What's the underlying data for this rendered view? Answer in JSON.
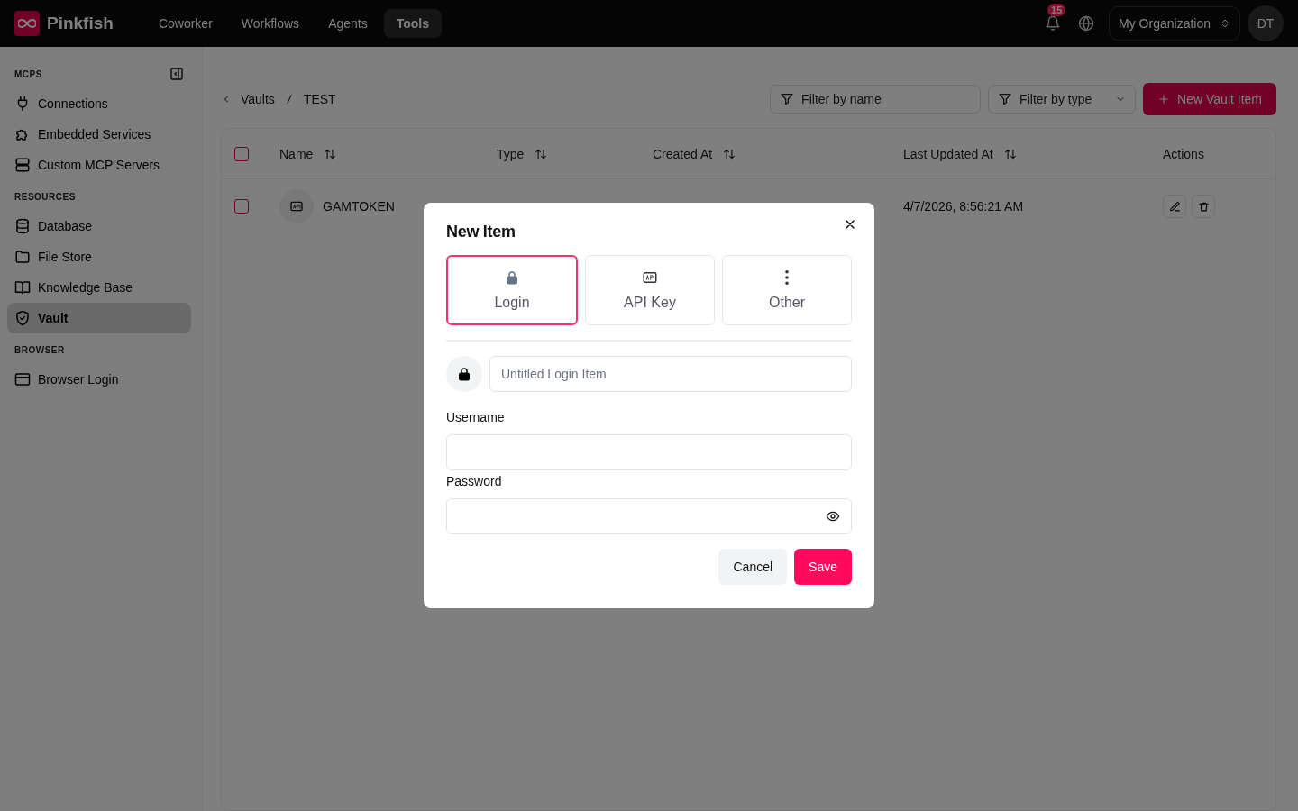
{
  "top_nav": {
    "brand": "Pinkfish",
    "items": [
      {
        "label": "Coworker",
        "selected": false
      },
      {
        "label": "Workflows",
        "selected": false
      },
      {
        "label": "Agents",
        "selected": false
      },
      {
        "label": "Tools",
        "selected": true
      }
    ],
    "notification_count": "15",
    "organization": "My Organization",
    "avatar": "DT"
  },
  "sidebar": {
    "sections": [
      {
        "title": "MCPS",
        "items": [
          {
            "label": "Connections",
            "kind": "plug",
            "selected": false
          },
          {
            "label": "Embedded Services",
            "kind": "puzzle",
            "selected": false
          },
          {
            "label": "Custom MCP Servers",
            "kind": "server",
            "selected": false
          }
        ]
      },
      {
        "title": "RESOURCES",
        "items": [
          {
            "label": "Database",
            "kind": "database",
            "selected": false
          },
          {
            "label": "File Store",
            "kind": "folder",
            "selected": false
          },
          {
            "label": "Knowledge Base",
            "kind": "book",
            "selected": false
          },
          {
            "label": "Vault",
            "kind": "shield",
            "selected": true
          }
        ]
      },
      {
        "title": "BROWSER",
        "items": [
          {
            "label": "Browser Login",
            "kind": "browser",
            "selected": false
          }
        ]
      }
    ]
  },
  "breadcrumb": [
    "Vaults",
    "TEST"
  ],
  "filters": {
    "name_placeholder": "Filter by name",
    "type_placeholder": "Filter by type"
  },
  "new_button": "New Vault Item",
  "table": {
    "all_selected": false,
    "columns": [
      {
        "label": "Name",
        "sortable": true
      },
      {
        "label": "Type",
        "sortable": true
      },
      {
        "label": "Created At",
        "sortable": true
      },
      {
        "label": "Last Updated At",
        "sortable": true
      },
      {
        "label": "Actions",
        "sortable": false
      }
    ],
    "rows": [
      {
        "checked": false,
        "name": "GAMTOKEN",
        "last_updated": "4/7/2026, 8:56:21 AM"
      }
    ]
  },
  "modal": {
    "title": "New Item",
    "types": [
      {
        "label": "Login",
        "kind": "login",
        "selected": true
      },
      {
        "label": "API Key",
        "kind": "api",
        "selected": false
      },
      {
        "label": "Other",
        "kind": "other",
        "selected": false
      }
    ],
    "name_placeholder": "Untitled Login Item",
    "fields": [
      {
        "label": "Username",
        "kind": "text"
      },
      {
        "label": "Password",
        "kind": "password"
      }
    ],
    "cancel": "Cancel",
    "save": "Save"
  }
}
